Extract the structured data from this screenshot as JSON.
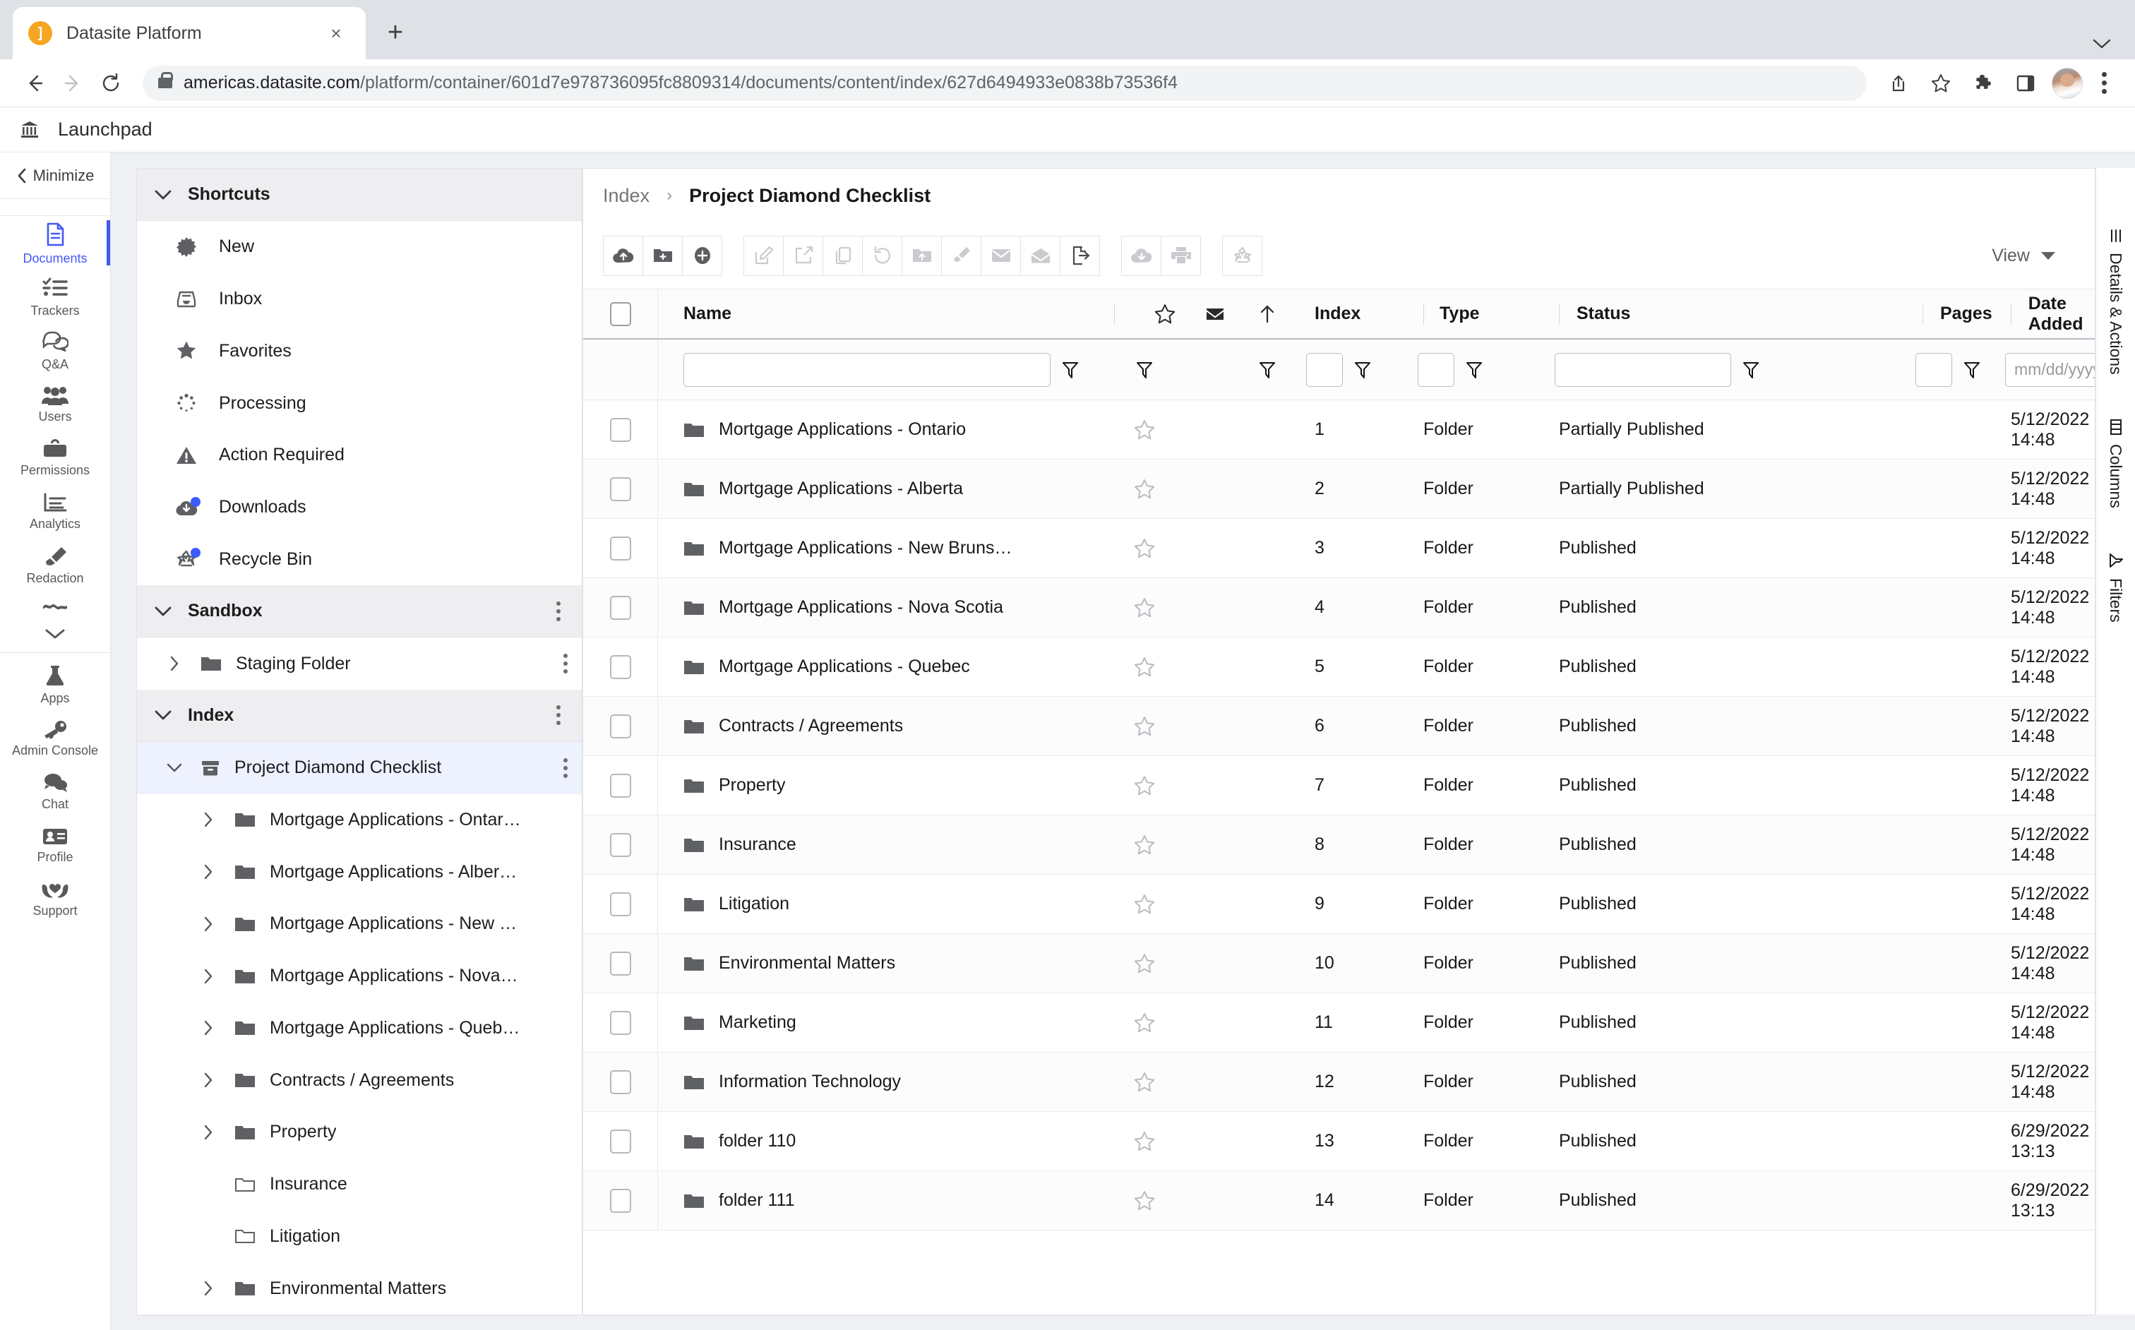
{
  "browser": {
    "tab_title": "Datasite Platform",
    "favicon_glyph": "]",
    "close_label": "×",
    "newtab_label": "+",
    "url_host": "americas.datasite.com",
    "url_path": "/platform/container/601d7e978736095fc8809314/documents/content/index/627d6494933e0838b73536f4"
  },
  "app_header": {
    "title": "Launchpad"
  },
  "rail": {
    "minimize_label": "Minimize",
    "items": [
      {
        "label": "Documents",
        "icon": "document-icon",
        "active": true
      },
      {
        "label": "Trackers",
        "icon": "checklist-icon",
        "active": false
      },
      {
        "label": "Q&A",
        "icon": "chat-bubbles-icon",
        "active": false
      },
      {
        "label": "Users",
        "icon": "people-icon",
        "active": false
      },
      {
        "label": "Permissions",
        "icon": "briefcase-icon",
        "active": false
      },
      {
        "label": "Analytics",
        "icon": "bar-report-icon",
        "active": false
      },
      {
        "label": "Redaction",
        "icon": "highlighter-icon",
        "active": false
      }
    ],
    "more_icon": "more-squiggle-icon",
    "bottom_items": [
      {
        "label": "Apps",
        "icon": "flask-icon"
      },
      {
        "label": "Admin Console",
        "icon": "key-icon"
      },
      {
        "label": "Chat",
        "icon": "chat-icon"
      },
      {
        "label": "Profile",
        "icon": "id-card-icon"
      },
      {
        "label": "Support",
        "icon": "hands-heart-icon"
      }
    ]
  },
  "explorer": {
    "shortcuts_header": "Shortcuts",
    "shortcuts": [
      {
        "label": "New",
        "icon": "burst-icon",
        "dot": false
      },
      {
        "label": "Inbox",
        "icon": "inbox-icon",
        "dot": false
      },
      {
        "label": "Favorites",
        "icon": "star-filled-icon",
        "dot": false
      },
      {
        "label": "Processing",
        "icon": "spinner-icon",
        "dot": false
      },
      {
        "label": "Action Required",
        "icon": "warning-icon",
        "dot": false
      },
      {
        "label": "Downloads",
        "icon": "cloud-download-icon",
        "dot": true
      },
      {
        "label": "Recycle Bin",
        "icon": "recycle-icon",
        "dot": true
      }
    ],
    "sandbox_header": "Sandbox",
    "sandbox_items": [
      {
        "label": "Staging Folder",
        "icon": "folder-icon",
        "twisty": "right",
        "depth": 1,
        "kebab": true
      }
    ],
    "index_header": "Index",
    "index_items": [
      {
        "label": "Project Diamond Checklist",
        "icon": "archive-icon",
        "twisty": "down",
        "depth": 1,
        "kebab": true,
        "selected": true
      },
      {
        "label": "Mortgage Applications - Ontar…",
        "icon": "folder-icon",
        "twisty": "right",
        "depth": 2,
        "kebab": false
      },
      {
        "label": "Mortgage Applications - Alber…",
        "icon": "folder-icon",
        "twisty": "right",
        "depth": 2,
        "kebab": false
      },
      {
        "label": "Mortgage Applications - New …",
        "icon": "folder-icon",
        "twisty": "right",
        "depth": 2,
        "kebab": false
      },
      {
        "label": "Mortgage Applications - Nova…",
        "icon": "folder-icon",
        "twisty": "right",
        "depth": 2,
        "kebab": false
      },
      {
        "label": "Mortgage Applications - Queb…",
        "icon": "folder-icon",
        "twisty": "right",
        "depth": 2,
        "kebab": false
      },
      {
        "label": "Contracts / Agreements",
        "icon": "folder-icon",
        "twisty": "right",
        "depth": 2,
        "kebab": false
      },
      {
        "label": "Property",
        "icon": "folder-icon",
        "twisty": "right",
        "depth": 2,
        "kebab": false
      },
      {
        "label": "Insurance",
        "icon": "folder-outline-icon",
        "twisty": "none",
        "depth": 2,
        "kebab": false
      },
      {
        "label": "Litigation",
        "icon": "folder-outline-icon",
        "twisty": "none",
        "depth": 2,
        "kebab": false
      },
      {
        "label": "Environmental Matters",
        "icon": "folder-icon",
        "twisty": "right",
        "depth": 2,
        "kebab": false
      }
    ]
  },
  "content": {
    "breadcrumb_root": "Index",
    "breadcrumb_sep": "›",
    "breadcrumb_current": "Project Diamond Checklist",
    "toolbar": {
      "group1": [
        {
          "name": "upload-cloud-icon",
          "disabled": false
        },
        {
          "name": "new-folder-icon",
          "disabled": false
        },
        {
          "name": "add-circle-icon",
          "disabled": false
        }
      ],
      "group2": [
        {
          "name": "edit-icon",
          "disabled": true
        },
        {
          "name": "share-icon",
          "disabled": true
        },
        {
          "name": "copy-icon",
          "disabled": true
        },
        {
          "name": "refresh-icon",
          "disabled": true
        },
        {
          "name": "move-to-folder-icon",
          "disabled": true
        },
        {
          "name": "highlighter-icon",
          "disabled": true
        },
        {
          "name": "envelope-closed-icon",
          "disabled": true
        },
        {
          "name": "envelope-open-icon",
          "disabled": true
        },
        {
          "name": "file-export-icon",
          "disabled": false
        }
      ],
      "group3": [
        {
          "name": "download-cloud-icon",
          "disabled": true
        },
        {
          "name": "print-icon",
          "disabled": true
        }
      ],
      "group4": [
        {
          "name": "recycle-icon",
          "disabled": true
        }
      ],
      "view_label": "View"
    },
    "table": {
      "columns": [
        "Name",
        "Index",
        "Type",
        "Status",
        "Pages",
        "Date Added"
      ],
      "header_icons": [
        "star-outline-icon",
        "envelope-icon",
        "arrow-up-icon"
      ],
      "filters": {
        "name_value": "",
        "index_value": "",
        "type_value": "",
        "status_value": "",
        "pages_value": "",
        "date_placeholder": "mm/dd/yyyy"
      },
      "rows": [
        {
          "name": "Mortgage Applications - Ontario",
          "index": "1",
          "type": "Folder",
          "status": "Partially Published",
          "pages": "",
          "date": "5/12/2022 14:48"
        },
        {
          "name": "Mortgage Applications - Alberta",
          "index": "2",
          "type": "Folder",
          "status": "Partially Published",
          "pages": "",
          "date": "5/12/2022 14:48"
        },
        {
          "name": "Mortgage Applications - New Bruns…",
          "index": "3",
          "type": "Folder",
          "status": "Published",
          "pages": "",
          "date": "5/12/2022 14:48"
        },
        {
          "name": "Mortgage Applications - Nova Scotia",
          "index": "4",
          "type": "Folder",
          "status": "Published",
          "pages": "",
          "date": "5/12/2022 14:48"
        },
        {
          "name": "Mortgage Applications - Quebec",
          "index": "5",
          "type": "Folder",
          "status": "Published",
          "pages": "",
          "date": "5/12/2022 14:48"
        },
        {
          "name": "Contracts / Agreements",
          "index": "6",
          "type": "Folder",
          "status": "Published",
          "pages": "",
          "date": "5/12/2022 14:48"
        },
        {
          "name": "Property",
          "index": "7",
          "type": "Folder",
          "status": "Published",
          "pages": "",
          "date": "5/12/2022 14:48"
        },
        {
          "name": "Insurance",
          "index": "8",
          "type": "Folder",
          "status": "Published",
          "pages": "",
          "date": "5/12/2022 14:48"
        },
        {
          "name": "Litigation",
          "index": "9",
          "type": "Folder",
          "status": "Published",
          "pages": "",
          "date": "5/12/2022 14:48"
        },
        {
          "name": "Environmental Matters",
          "index": "10",
          "type": "Folder",
          "status": "Published",
          "pages": "",
          "date": "5/12/2022 14:48"
        },
        {
          "name": "Marketing",
          "index": "11",
          "type": "Folder",
          "status": "Published",
          "pages": "",
          "date": "5/12/2022 14:48"
        },
        {
          "name": "Information Technology",
          "index": "12",
          "type": "Folder",
          "status": "Published",
          "pages": "",
          "date": "5/12/2022 14:48"
        },
        {
          "name": "folder 110",
          "index": "13",
          "type": "Folder",
          "status": "Published",
          "pages": "",
          "date": "6/29/2022 13:13"
        },
        {
          "name": "folder 111",
          "index": "14",
          "type": "Folder",
          "status": "Published",
          "pages": "",
          "date": "6/29/2022 13:13"
        }
      ]
    }
  },
  "right_rail": [
    {
      "label": "Details & Actions",
      "icon": "list-lines-icon"
    },
    {
      "label": "Columns",
      "icon": "columns-icon"
    },
    {
      "label": "Filters",
      "icon": "funnel-icon"
    }
  ],
  "colors": {
    "accent": "#4458f5",
    "badge": "#3d5afe",
    "favicon": "#f5a623"
  }
}
